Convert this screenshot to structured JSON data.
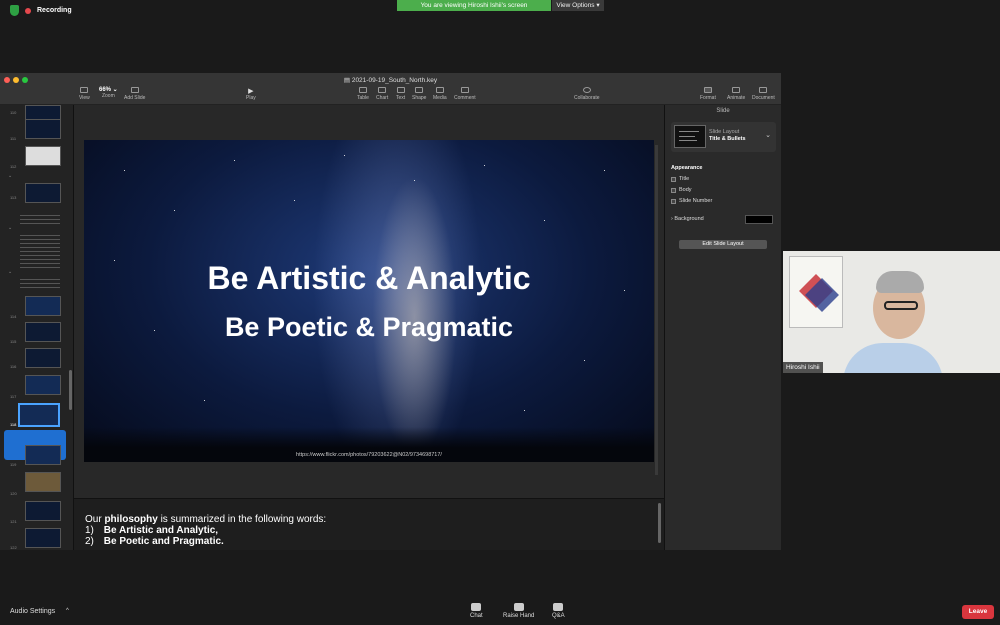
{
  "zoom": {
    "recording_label": "Recording",
    "share_banner": "You are viewing Hiroshi Ishii's screen",
    "view_options": "View Options",
    "participant_name": "Hiroshi Ishii",
    "audio_settings": "Audio Settings",
    "controls": [
      {
        "label": "Chat",
        "icon": "chat-icon"
      },
      {
        "label": "Raise Hand",
        "icon": "hand-icon"
      },
      {
        "label": "Q&A",
        "icon": "qa-icon"
      }
    ],
    "leave": "Leave"
  },
  "keynote": {
    "document_title": "2021-09-19_South_North.key",
    "zoom_level": "66%",
    "toolbar_left": [
      {
        "label": "View",
        "icon": "view-icon"
      },
      {
        "label": "Zoom",
        "icon": "zoom-icon"
      },
      {
        "label": "Add Slide",
        "icon": "add-slide-icon"
      }
    ],
    "play": "Play",
    "toolbar_center": [
      {
        "label": "Table",
        "icon": "table-icon"
      },
      {
        "label": "Chart",
        "icon": "chart-icon"
      },
      {
        "label": "Text",
        "icon": "text-icon"
      },
      {
        "label": "Shape",
        "icon": "shape-icon"
      },
      {
        "label": "Media",
        "icon": "media-icon"
      },
      {
        "label": "Comment",
        "icon": "comment-icon"
      }
    ],
    "collaborate": "Collaborate",
    "toolbar_right": [
      {
        "label": "Format",
        "icon": "format-icon"
      },
      {
        "label": "Animate",
        "icon": "animate-icon"
      },
      {
        "label": "Document",
        "icon": "document-icon"
      }
    ],
    "navigator_numbers": [
      "110",
      "111",
      "112",
      "113",
      "114",
      "115",
      "116",
      "117",
      "118",
      "119",
      "120",
      "121",
      "122"
    ],
    "slide": {
      "line1": "Be Artistic & Analytic",
      "line2": "Be Poetic & Pragmatic",
      "credit_url": "https://www.flickr.com/photos/79203622@N02/9734698717/"
    },
    "notes": {
      "prefix": "Our ",
      "bold_word": "philosophy",
      "suffix": " is summarized in the following words:",
      "items": [
        {
          "num": "1)",
          "text": "Be Artistic and Analytic,"
        },
        {
          "num": "2)",
          "text": "Be Poetic and Pragmatic."
        }
      ]
    },
    "inspector": {
      "tab": "Slide",
      "layout_label": "Slide Layout",
      "layout_value": "Title & Bullets",
      "appearance": "Appearance",
      "checkboxes": [
        "Title",
        "Body",
        "Slide Number"
      ],
      "background": "Background",
      "edit_layout": "Edit Slide Layout"
    }
  }
}
